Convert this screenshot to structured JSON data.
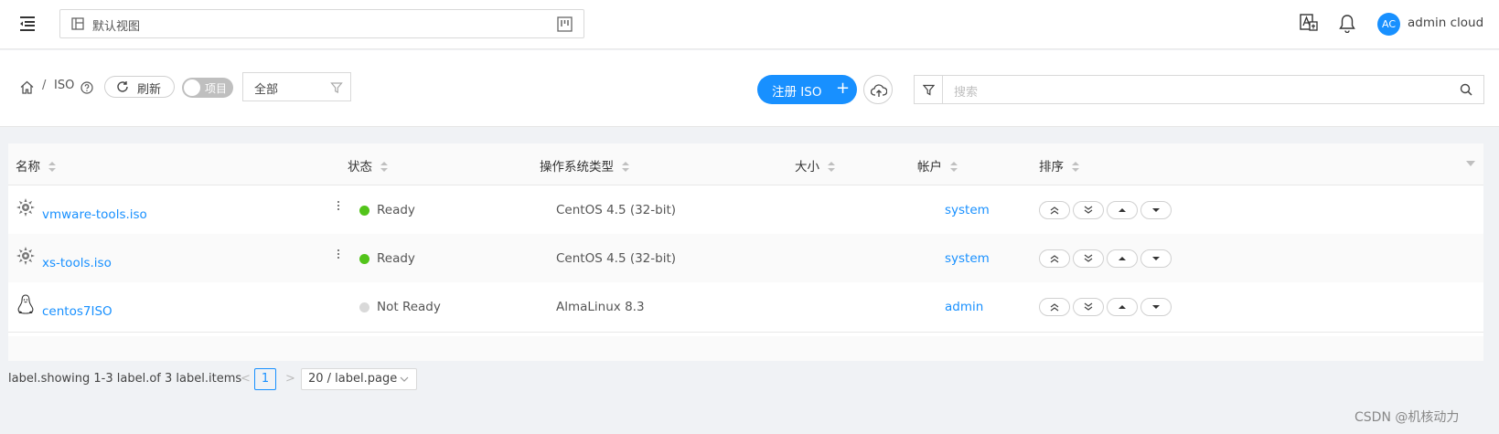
{
  "topbar": {
    "view_label": "默认视图",
    "username": "admin cloud",
    "avatar_initials": "AC"
  },
  "toolbar": {
    "breadcrumb": [
      "ISO"
    ],
    "refresh_label": "刷新",
    "toggle_label": "项目",
    "scope_select": "全部",
    "register_label": "注册 ISO",
    "search_placeholder": "搜索"
  },
  "table": {
    "columns": [
      "名称",
      "状态",
      "操作系统类型",
      "大小",
      "帐户",
      "排序"
    ],
    "rows": [
      {
        "name": "vmware-tools.iso",
        "status": "Ready",
        "os": "CentOS 4.5 (32-bit)",
        "size": "",
        "account": "system",
        "icon": "gear-os-icon"
      },
      {
        "name": "xs-tools.iso",
        "status": "Ready",
        "os": "CentOS 4.5 (32-bit)",
        "size": "",
        "account": "system",
        "icon": "gear-os-icon"
      },
      {
        "name": "centos7ISO",
        "status": "Not Ready",
        "os": "AlmaLinux 8.3",
        "size": "",
        "account": "admin",
        "icon": "linux-penguin-icon"
      }
    ]
  },
  "pagination": {
    "summary": "label.showing 1-3 label.of 3 label.items",
    "current_page": "1",
    "page_size": "20 / label.page"
  },
  "colors": {
    "primary": "#1890ff",
    "ready": "#52c41a",
    "not_ready": "#d9d9d9"
  },
  "watermark": "CSDN @机核动力"
}
